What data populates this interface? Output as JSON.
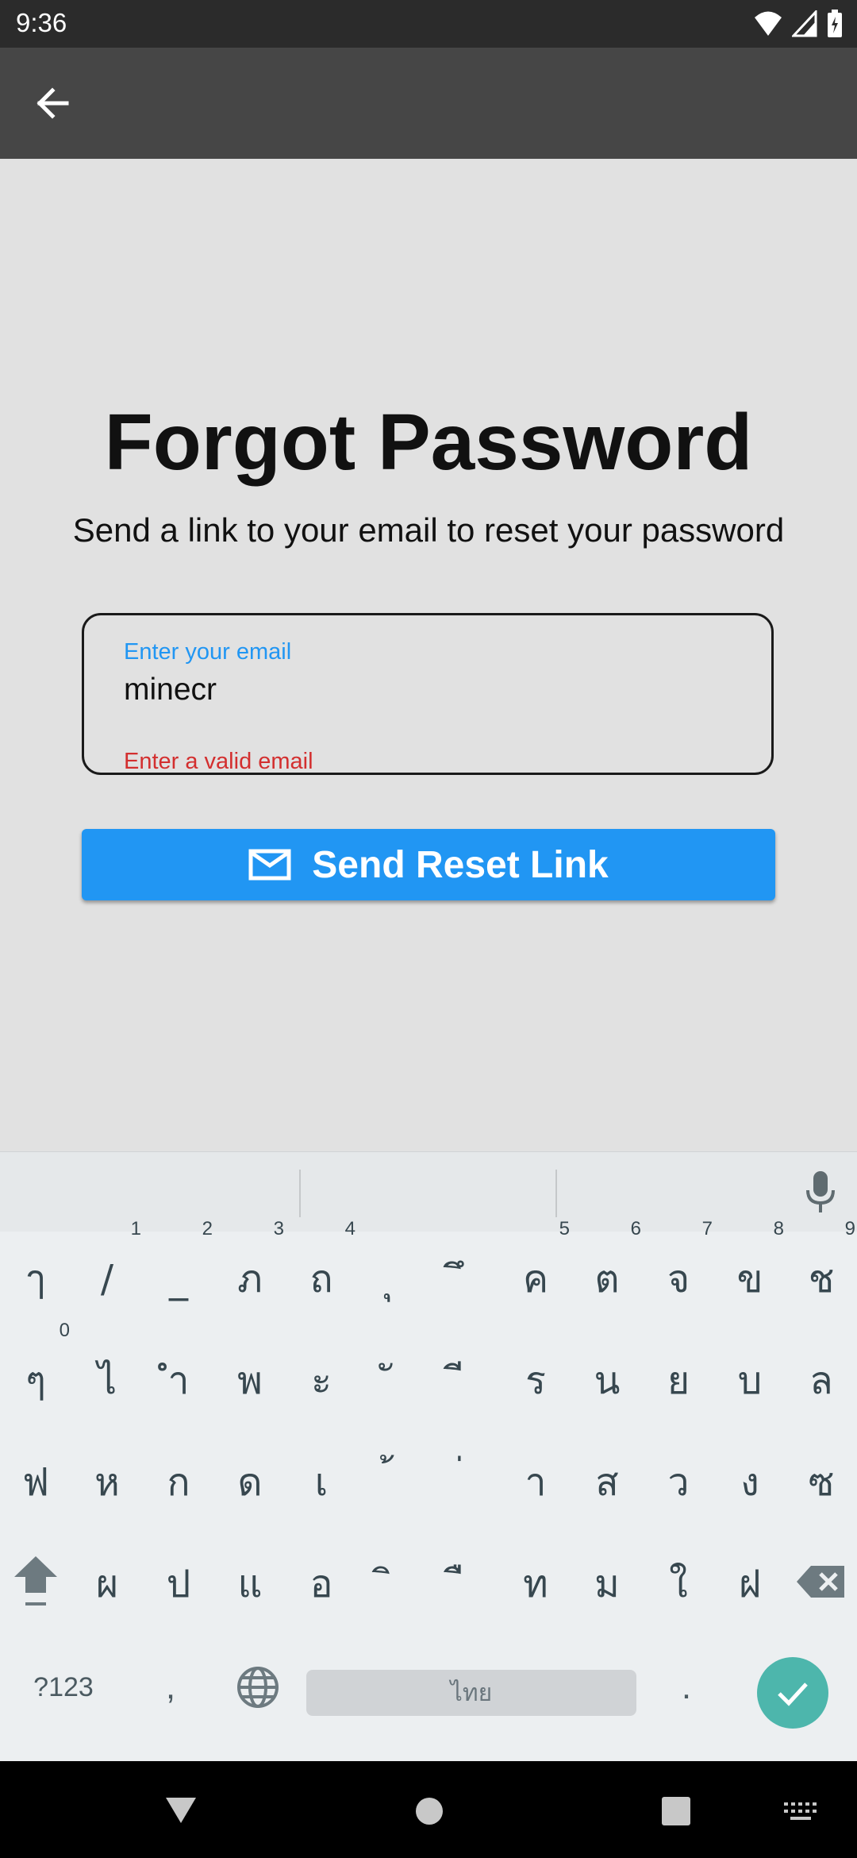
{
  "status": {
    "time": "9:36"
  },
  "icons": {
    "back": "arrow-back-icon",
    "wifi": "wifi-icon",
    "signal": "signal-icon",
    "battery": "battery-icon",
    "mail": "mail-icon",
    "mic": "microphone-icon",
    "shift": "shift-icon",
    "backspace": "backspace-icon",
    "globe": "globe-icon",
    "enter": "check-icon"
  },
  "page": {
    "title": "Forgot Password",
    "subtitle": "Send a link to your email to reset your password"
  },
  "email": {
    "label": "Enter your email",
    "value": "minecr",
    "error": "Enter a valid email"
  },
  "button": {
    "label": "Send Reset Link"
  },
  "colors": {
    "accent": "#2196f3",
    "error": "#d32f2f",
    "enter_key": "#4db6ac"
  },
  "keyboard": {
    "row1": [
      {
        "k": "ๅ",
        "h": ""
      },
      {
        "k": "/",
        "h": "1"
      },
      {
        "k": "_",
        "h": "2"
      },
      {
        "k": "ภ",
        "h": "3"
      },
      {
        "k": "ถ",
        "h": "4"
      },
      {
        "k": "ุ",
        "h": ""
      },
      {
        "k": "ึ",
        "h": ""
      },
      {
        "k": "ค",
        "h": "5"
      },
      {
        "k": "ต",
        "h": "6"
      },
      {
        "k": "จ",
        "h": "7"
      },
      {
        "k": "ข",
        "h": "8"
      },
      {
        "k": "ช",
        "h": "9"
      }
    ],
    "row2": [
      {
        "k": "ๆ",
        "h": "0"
      },
      {
        "k": "ไ",
        "h": ""
      },
      {
        "k": "ำ",
        "h": ""
      },
      {
        "k": "พ",
        "h": ""
      },
      {
        "k": "ะ",
        "h": ""
      },
      {
        "k": "ั",
        "h": ""
      },
      {
        "k": "ี",
        "h": ""
      },
      {
        "k": "ร",
        "h": ""
      },
      {
        "k": "น",
        "h": ""
      },
      {
        "k": "ย",
        "h": ""
      },
      {
        "k": "บ",
        "h": ""
      },
      {
        "k": "ล",
        "h": ""
      }
    ],
    "row3": [
      {
        "k": "ฟ",
        "h": ""
      },
      {
        "k": "ห",
        "h": ""
      },
      {
        "k": "ก",
        "h": ""
      },
      {
        "k": "ด",
        "h": ""
      },
      {
        "k": "เ",
        "h": ""
      },
      {
        "k": "้",
        "h": ""
      },
      {
        "k": "่",
        "h": ""
      },
      {
        "k": "า",
        "h": ""
      },
      {
        "k": "ส",
        "h": ""
      },
      {
        "k": "ว",
        "h": ""
      },
      {
        "k": "ง",
        "h": ""
      },
      {
        "k": "ซ",
        "h": ""
      }
    ],
    "row4": [
      {
        "k": "ผ",
        "h": ""
      },
      {
        "k": "ป",
        "h": ""
      },
      {
        "k": "แ",
        "h": ""
      },
      {
        "k": "อ",
        "h": ""
      },
      {
        "k": "ิ",
        "h": ""
      },
      {
        "k": "ื",
        "h": ""
      },
      {
        "k": "ท",
        "h": ""
      },
      {
        "k": "ม",
        "h": ""
      },
      {
        "k": "ใ",
        "h": ""
      },
      {
        "k": "ฝ",
        "h": ""
      }
    ],
    "symbols_label": "?123",
    "comma": ",",
    "space_label": "ไทย",
    "period": "."
  }
}
